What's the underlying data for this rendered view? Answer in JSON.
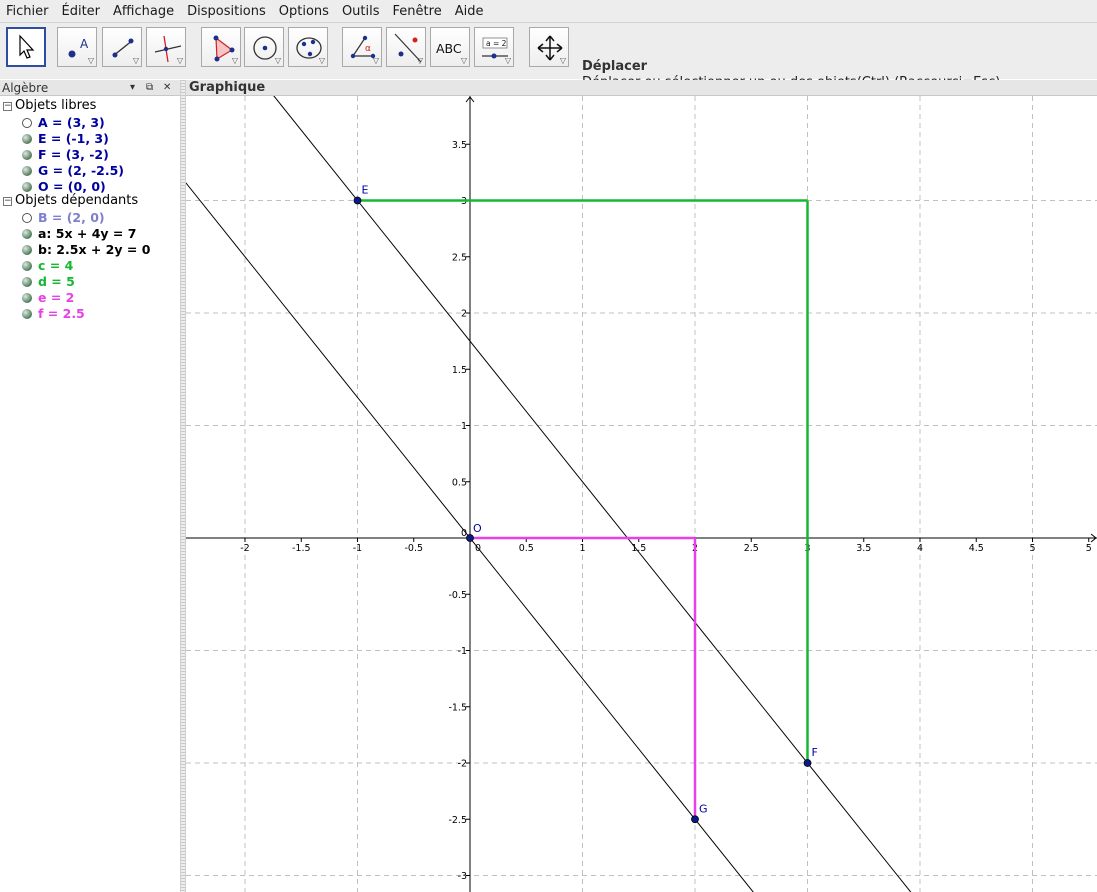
{
  "menu": [
    "Fichier",
    "Éditer",
    "Affichage",
    "Dispositions",
    "Options",
    "Outils",
    "Fenêtre",
    "Aide"
  ],
  "toolbar": {
    "tools": [
      {
        "name": "move-tool-button",
        "icon": "cursor-arrow-icon",
        "selected": true
      },
      {
        "name": "point-tool-button",
        "icon": "point-icon",
        "label": "A"
      },
      {
        "name": "line-tool-button",
        "icon": "line-icon"
      },
      {
        "name": "perpendicular-tool-button",
        "icon": "perpendicular-line-icon"
      },
      {
        "name": "polygon-tool-button",
        "icon": "polygon-icon"
      },
      {
        "name": "circle-tool-button",
        "icon": "circle-icon"
      },
      {
        "name": "conic-tool-button",
        "icon": "ellipse-icon"
      },
      {
        "name": "angle-tool-button",
        "icon": "angle-icon",
        "label": "α"
      },
      {
        "name": "reflect-tool-button",
        "icon": "reflect-line-icon"
      },
      {
        "name": "text-tool-button",
        "icon": "text-icon",
        "label": "ABC"
      },
      {
        "name": "slider-tool-button",
        "icon": "slider-icon",
        "label": "a = 2"
      },
      {
        "name": "move-view-tool-button",
        "icon": "move-arrows-icon"
      }
    ],
    "tool_title": "Déplacer",
    "tool_help": "Déplacer ou sélectionner un ou des objets(Ctrl) (Raccourci=Esc)"
  },
  "algebra": {
    "title": "Algèbre",
    "free_group": "Objets libres",
    "dependent_group": "Objets dépendants",
    "free": [
      {
        "text": "A = (3, 3)",
        "color": "#0000a0",
        "visible": false
      },
      {
        "text": "E = (-1, 3)",
        "color": "#0000a0",
        "visible": true
      },
      {
        "text": "F = (3, -2)",
        "color": "#0000a0",
        "visible": true
      },
      {
        "text": "G = (2, -2.5)",
        "color": "#0000a0",
        "visible": true
      },
      {
        "text": "O = (0, 0)",
        "color": "#0000a0",
        "visible": true
      }
    ],
    "dependent": [
      {
        "text": "B = (2, 0)",
        "color": "#7f7fd0",
        "visible": false
      },
      {
        "text": "a: 5x + 4y = 7",
        "color": "#000000",
        "visible": true
      },
      {
        "text": "b: 2.5x + 2y = 0",
        "color": "#000000",
        "visible": true
      },
      {
        "text": "c = 4",
        "color": "#16b832",
        "visible": true
      },
      {
        "text": "d = 5",
        "color": "#16b832",
        "visible": true
      },
      {
        "text": "e = 2",
        "color": "#e640e6",
        "visible": true
      },
      {
        "text": "f = 2.5",
        "color": "#e640e6",
        "visible": true
      }
    ]
  },
  "graphics": {
    "title": "Graphique",
    "points": [
      {
        "label": "E",
        "x": -1,
        "y": 3
      },
      {
        "label": "F",
        "x": 3,
        "y": -2
      },
      {
        "label": "G",
        "x": 2,
        "y": -2.5
      },
      {
        "label": "O",
        "x": 0,
        "y": 0
      }
    ],
    "lines": [
      {
        "name": "a",
        "equation": "5x + 4y = 7",
        "a": 5,
        "b": 4,
        "c": 7,
        "color": "#000000"
      },
      {
        "name": "b",
        "equation": "2.5x + 2y = 0",
        "a": 2.5,
        "b": 2,
        "c": 0,
        "color": "#000000"
      }
    ],
    "segments": [
      {
        "from": [
          -1,
          3
        ],
        "to": [
          3,
          3
        ],
        "color": "#16b832"
      },
      {
        "from": [
          3,
          3
        ],
        "to": [
          3,
          -2
        ],
        "color": "#16b832"
      },
      {
        "from": [
          0,
          0
        ],
        "to": [
          2,
          0
        ],
        "color": "#e640e6"
      },
      {
        "from": [
          2,
          0
        ],
        "to": [
          2,
          -2.5
        ],
        "color": "#e640e6"
      }
    ],
    "x_ticks": [
      "-2",
      "-1.5",
      "-1",
      "-0.5",
      "0",
      "0.5",
      "1",
      "1.5",
      "2",
      "2.5",
      "3",
      "3.5",
      "4",
      "4.5",
      "5",
      "5"
    ],
    "y_ticks": [
      "3.5",
      "3",
      "2.5",
      "2",
      "1.5",
      "1",
      "0.5",
      "0",
      "-0.5",
      "-1",
      "-1.5",
      "-2",
      "-2.5",
      "-3"
    ],
    "grid": true,
    "x_range": [
      -2.5,
      5.5
    ],
    "y_range": [
      -3.1,
      3.9
    ]
  }
}
